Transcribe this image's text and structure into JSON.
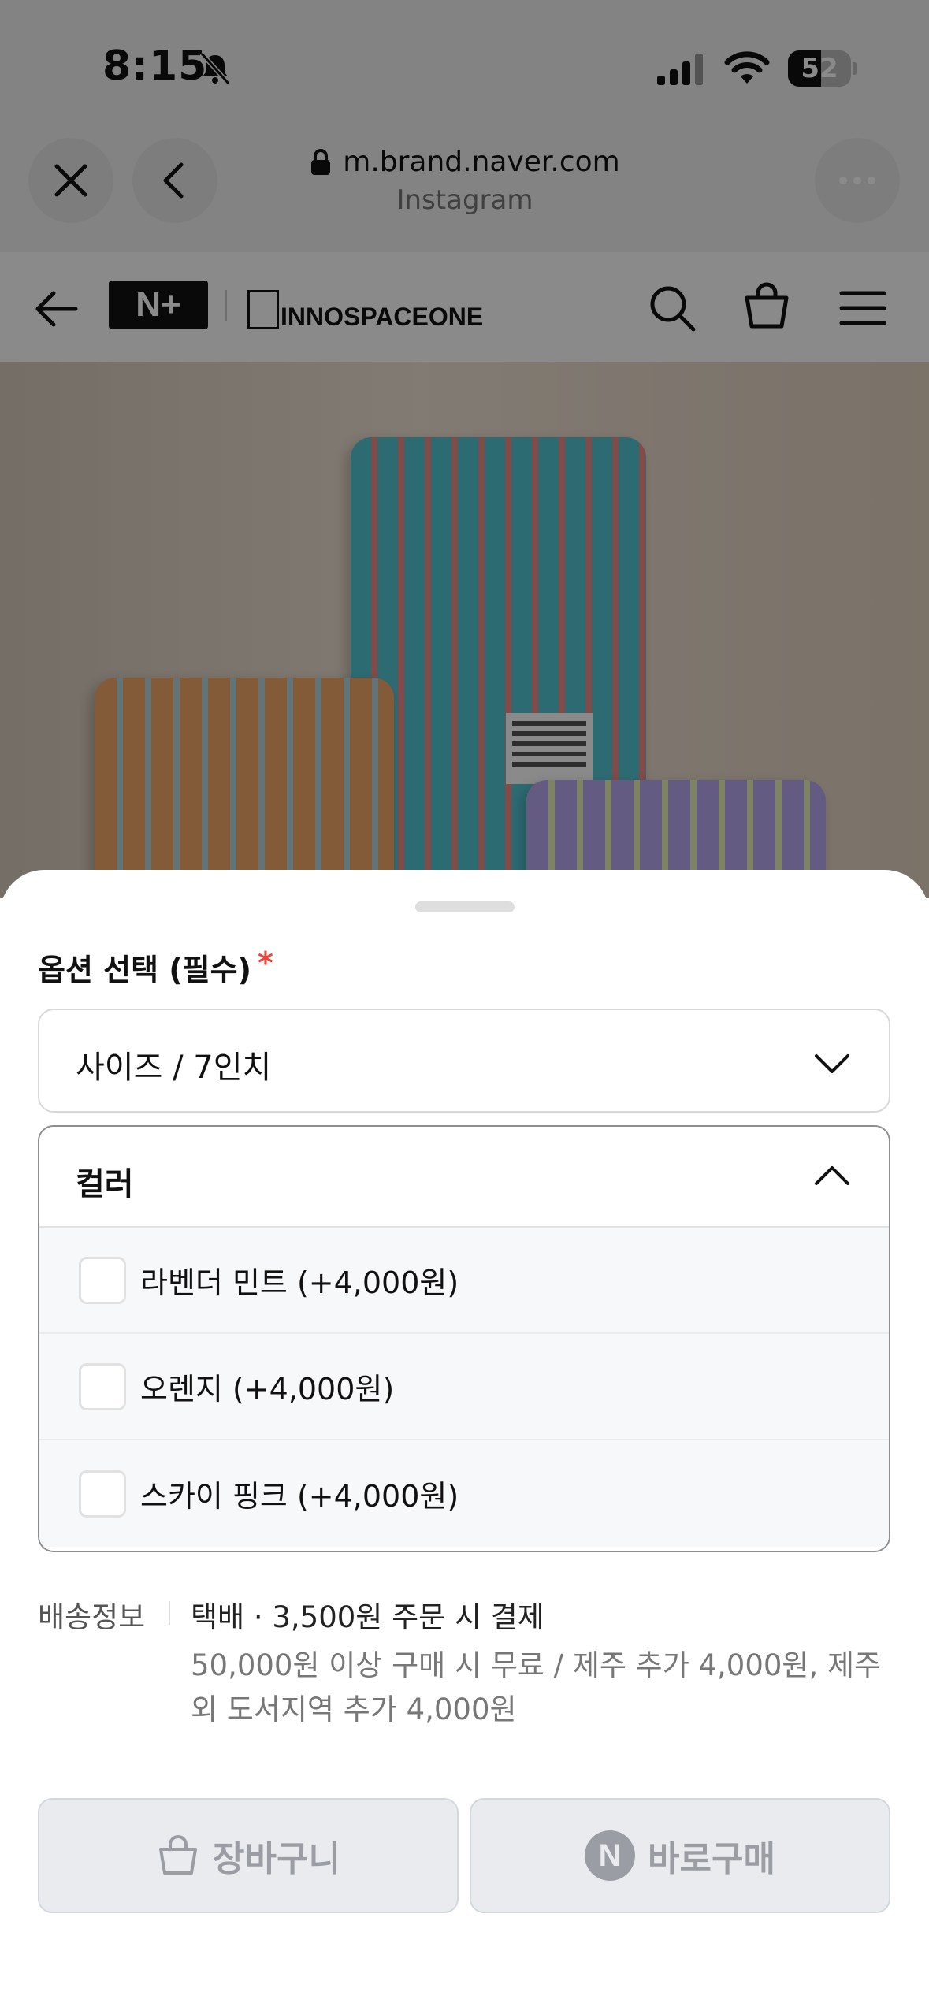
{
  "status_bar": {
    "time": "8:15",
    "battery_level": "52",
    "battery_fraction": 0.52
  },
  "browser": {
    "url": "m.brand.naver.com",
    "source": "Instagram"
  },
  "site_header": {
    "nplus_logo": "N+",
    "brand_name": "INNOSPACEONE",
    "icons": [
      "back-arrow-icon",
      "search-icon",
      "shopping-bag-icon",
      "hamburger-menu-icon"
    ]
  },
  "product_image": {
    "tag_text": "THE SPICE IS READY TO MADE YOUR DREAMS HAPPEN INNOSPACEONE"
  },
  "sheet": {
    "section_title": "옵션 선택 (필수)",
    "required_mark": "*",
    "size_select": {
      "value": "사이즈 / 7인치"
    },
    "color_select": {
      "label": "컬러",
      "options": [
        {
          "label": "라벤더 민트 (+4,000원)",
          "checked": false
        },
        {
          "label": "오렌지 (+4,000원)",
          "checked": false
        },
        {
          "label": "스카이 핑크 (+4,000원)",
          "checked": false
        }
      ]
    },
    "shipping": {
      "label": "배송정보",
      "main": "택배 · 3,500원 주문 시 결제",
      "detail": "50,000원 이상 구매 시 무료 / 제주 추가 4,000원, 제주 외 도서지역 추가 4,000원"
    },
    "buttons": {
      "cart": "장바구니",
      "buy_badge": "N",
      "buy": "바로구매"
    }
  },
  "colors": {
    "required": "#f04438",
    "disabled_button_bg": "#e9ebee",
    "disabled_button_text": "#9a9ea4",
    "option_row_bg": "#f7f8fa"
  }
}
